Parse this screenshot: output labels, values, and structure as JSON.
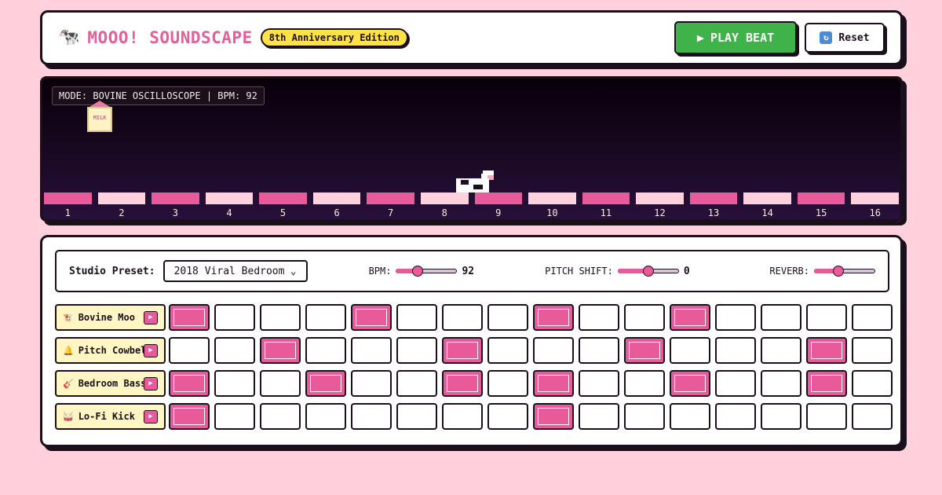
{
  "header": {
    "icon": "cow-emoji-icon",
    "title": "MOOO! SOUNDSCAPE",
    "badge": "8th Anniversary Edition",
    "play_label": "PLAY BEAT",
    "play_icon": "play-triangle-icon",
    "reset_label": "Reset",
    "reset_icon": "refresh-icon"
  },
  "visualizer": {
    "mode_text": "MODE: BOVINE OSCILLOSCOPE | BPM: 92",
    "milk_label": "MILK",
    "step_numbers": [
      "1",
      "2",
      "3",
      "4",
      "5",
      "6",
      "7",
      "8",
      "9",
      "10",
      "11",
      "12",
      "13",
      "14",
      "15",
      "16"
    ],
    "step_states": [
      true,
      false,
      true,
      false,
      true,
      false,
      true,
      false,
      true,
      false,
      true,
      false,
      true,
      false,
      true,
      false
    ],
    "cow_position_step": 8
  },
  "controls": {
    "preset_label": "Studio Preset:",
    "preset_value": "2018 Viral Bedroom",
    "bpm_label": "BPM:",
    "bpm_value": "92",
    "bpm_level": 0.35,
    "pitch_label": "PITCH SHIFT:",
    "pitch_value": "0",
    "pitch_level": 0.5,
    "reverb_label": "REVERB:",
    "reverb_level": 0.4
  },
  "tracks": [
    {
      "emoji": "🐮",
      "name": "Bovine Moo",
      "steps": [
        1,
        0,
        0,
        0,
        1,
        0,
        0,
        0,
        1,
        0,
        0,
        1,
        0,
        0,
        0,
        0
      ]
    },
    {
      "emoji": "🔔",
      "name": "Pitch Cowbell",
      "steps": [
        0,
        0,
        1,
        0,
        0,
        0,
        1,
        0,
        0,
        0,
        1,
        0,
        0,
        0,
        1,
        0
      ]
    },
    {
      "emoji": "🎸",
      "name": "Bedroom Bass",
      "steps": [
        1,
        0,
        0,
        1,
        0,
        0,
        1,
        0,
        1,
        0,
        0,
        1,
        0,
        0,
        1,
        0
      ]
    },
    {
      "emoji": "🥁",
      "name": "Lo-Fi Kick",
      "steps": [
        1,
        0,
        0,
        0,
        0,
        0,
        0,
        0,
        1,
        0,
        0,
        0,
        0,
        0,
        0,
        0
      ]
    }
  ],
  "colors": {
    "background": "#ffd1dc",
    "accent_pink": "#e85a9a",
    "title_pink": "#e0609a",
    "play_green": "#3fb24a",
    "badge_yellow": "#ffe14a",
    "label_cream": "#fff6c4"
  }
}
